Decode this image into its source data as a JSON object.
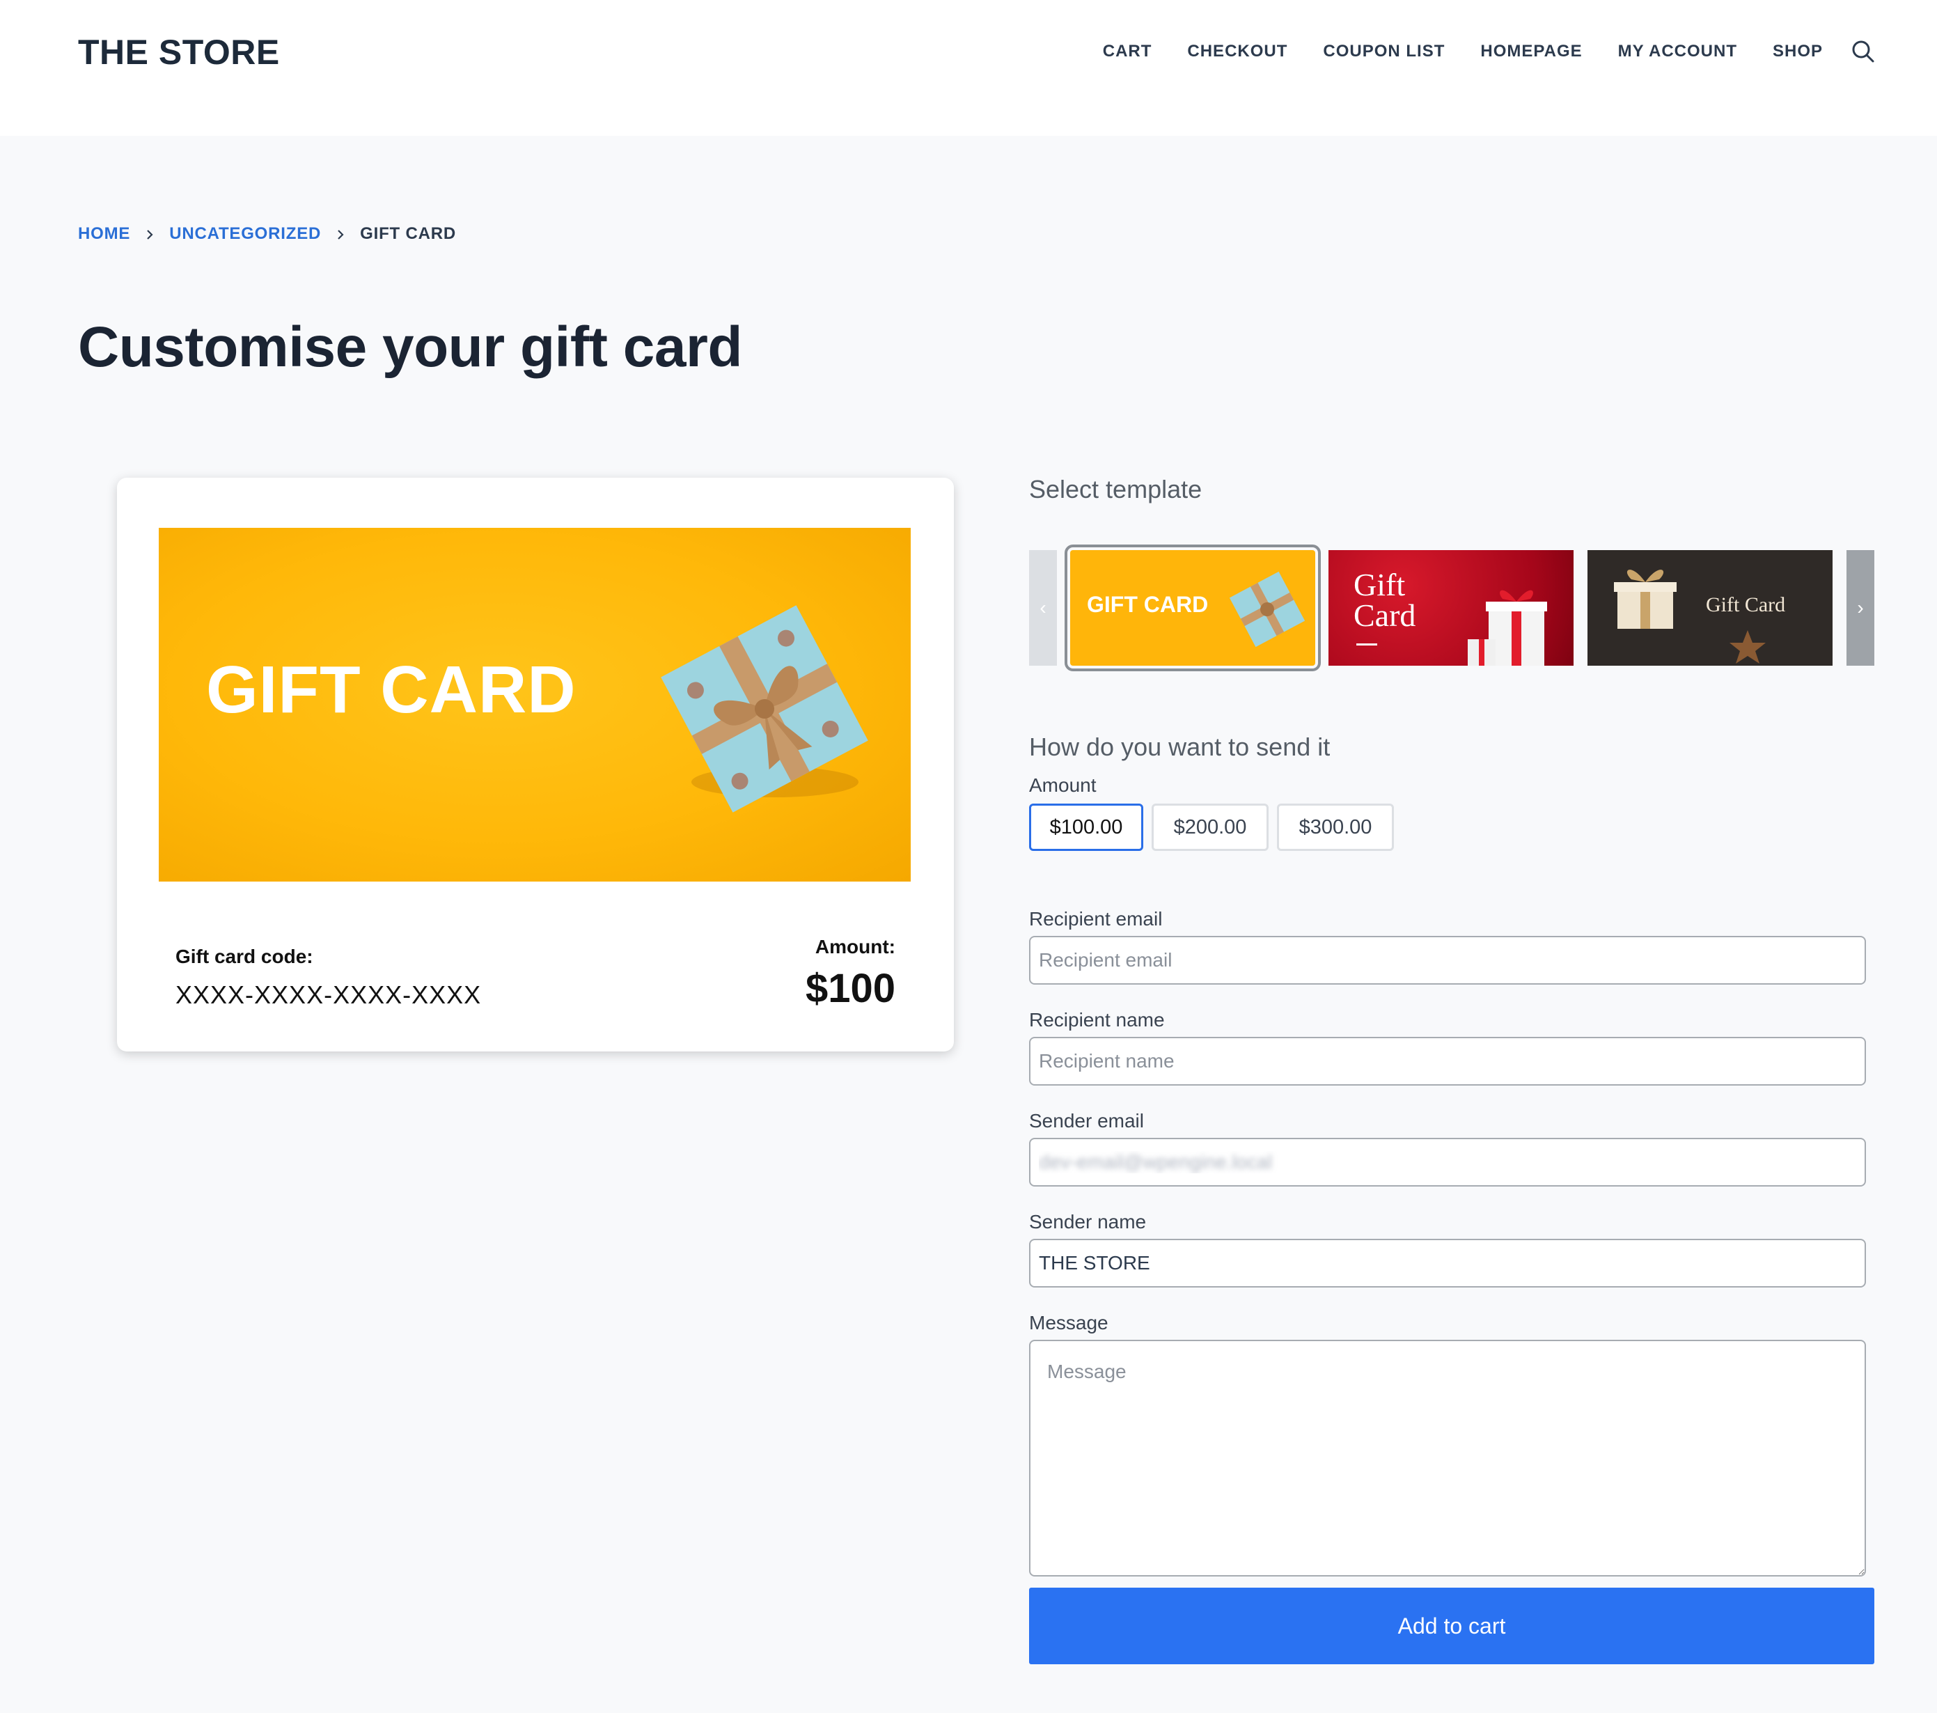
{
  "header": {
    "brand": "THE STORE",
    "nav": [
      "CART",
      "CHECKOUT",
      "COUPON LIST",
      "HOMEPAGE",
      "MY ACCOUNT",
      "SHOP"
    ]
  },
  "breadcrumb": {
    "home": "HOME",
    "category": "UNCATEGORIZED",
    "current": "GIFT CARD"
  },
  "page_title": "Customise your gift card",
  "preview": {
    "image_text": "GIFT CARD",
    "code_label": "Gift card code:",
    "code_value": "XXXX-XXXX-XXXX-XXXX",
    "amount_label": "Amount:",
    "amount_value": "$100"
  },
  "templates": {
    "title": "Select template",
    "prev_arrow": "‹",
    "next_arrow": "›",
    "items": [
      {
        "text": "GIFT CARD",
        "selected": true,
        "color": "#ffb50a"
      },
      {
        "text": "Gift Card",
        "selected": false,
        "color": "#c0102a"
      },
      {
        "text": "Gift Card",
        "selected": false,
        "color": "#2f2a27"
      }
    ]
  },
  "send": {
    "title": "How do you want to send it",
    "amount_label": "Amount",
    "amounts": [
      "$100.00",
      "$200.00",
      "$300.00"
    ],
    "selected_amount": "$100.00"
  },
  "form": {
    "recipient_email_label": "Recipient email",
    "recipient_email_placeholder": "Recipient email",
    "recipient_name_label": "Recipient name",
    "recipient_name_placeholder": "Recipient name",
    "sender_email_label": "Sender email",
    "sender_email_value": "dev-email@wpengine.local",
    "sender_name_label": "Sender name",
    "sender_name_value": "THE STORE",
    "message_label": "Message",
    "message_placeholder": "Message",
    "submit": "Add to cart"
  },
  "colors": {
    "accent": "#2a72f2",
    "link": "#2b6fd6",
    "card_yellow": "#ffb809"
  }
}
